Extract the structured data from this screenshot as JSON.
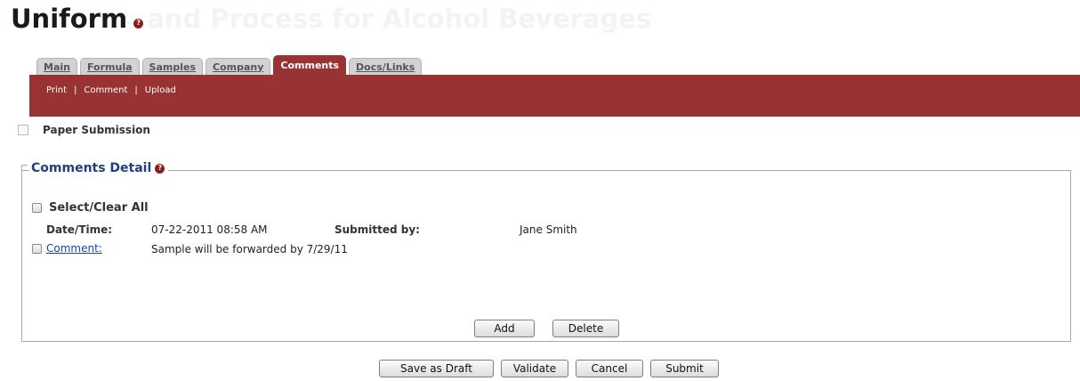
{
  "header": {
    "title": "Uniform",
    "title_faded": "and Process for Alcohol Beverages",
    "help_icon": "question-mark-icon"
  },
  "tabs": [
    {
      "label": "Main",
      "active": false
    },
    {
      "label": "Formula",
      "active": false
    },
    {
      "label": "Samples",
      "active": false
    },
    {
      "label": "Company",
      "active": false
    },
    {
      "label": "Comments",
      "active": true
    },
    {
      "label": "Docs/Links",
      "active": false
    }
  ],
  "subnav": {
    "links": [
      "Print",
      "Comment",
      "Upload"
    ],
    "separator": "|"
  },
  "paper_submission": {
    "label": "Paper Submission",
    "checked": false
  },
  "comments_detail": {
    "legend": "Comments Detail",
    "select_all_label": "Select/Clear All",
    "date_time_label": "Date/Time:",
    "date_time_value": "07-22-2011 08:58 AM",
    "submitted_by_label": "Submitted by:",
    "submitted_by_value": "Jane Smith",
    "comment_link": "Comment:",
    "comment_text": "Sample will be forwarded by 7/29/11",
    "add_button": "Add",
    "delete_button": "Delete"
  },
  "footer_buttons": {
    "save_draft": "Save as Draft",
    "validate": "Validate",
    "cancel": "Cancel",
    "submit": "Submit"
  },
  "colors": {
    "accent": "#993333",
    "legend_text": "#1f3f7f",
    "link": "#1a3fbf",
    "help_icon": "#8b1d1d"
  }
}
